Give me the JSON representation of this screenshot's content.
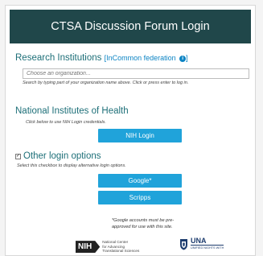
{
  "header": {
    "title": "CTSA Discussion Forum Login"
  },
  "research": {
    "title": "Research Institutions",
    "federation_link": "[InCommon federation",
    "federation_close": "]",
    "info_icon": "i",
    "placeholder": "Choose an organization...",
    "hint": "Search by typing part of your organization name above. Click or press enter to log in."
  },
  "nih": {
    "title": "National Institutes of Health",
    "hint": "Click below to use NIH Login credentials.",
    "button_label": "NIH Login"
  },
  "other": {
    "title": "Other login options",
    "checked_mark": "✓",
    "hint": "Select this checkbox to display alternative login options.",
    "google_label": "Google*",
    "scripps_label": "Scripps",
    "note": "*Google accounts must be pre-approved for use with this site."
  },
  "footer": {
    "nih_badge": "NIH",
    "nih_line1": "National Center",
    "nih_line2": "for Advancing",
    "nih_line3": "Translational Sciences",
    "una_title": "UNA",
    "una_sub": "UNIFIED NIGHTS WITH"
  },
  "colors": {
    "header_bg": "#20474a",
    "accent_teal": "#1d6f78",
    "button_blue": "#20a3da",
    "link_blue": "#0c84c4"
  }
}
